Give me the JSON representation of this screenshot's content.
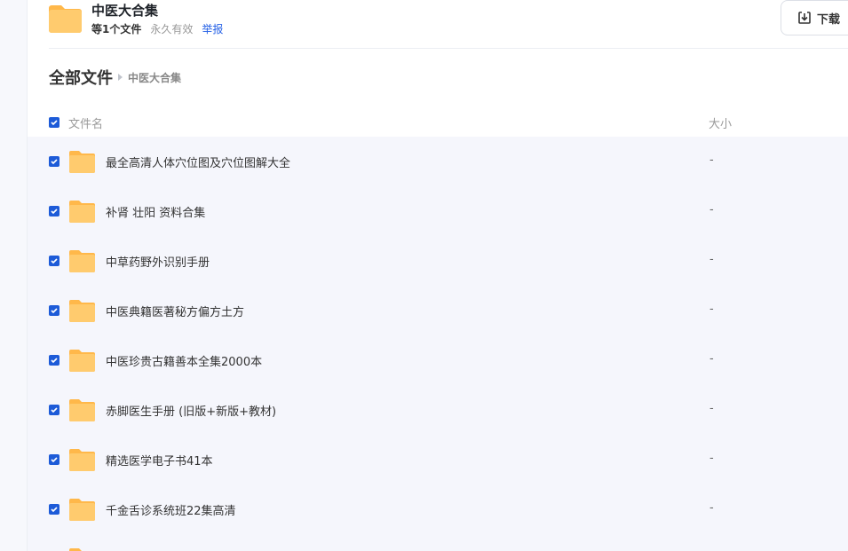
{
  "share": {
    "title": "中医大合集",
    "count_label": "等1个文件",
    "expiry_label": "永久有效",
    "report_label": "举报"
  },
  "toolbar": {
    "download_label": "下载"
  },
  "breadcrumb": {
    "root": "全部文件",
    "current": "中医大合集"
  },
  "list": {
    "columns": {
      "name": "文件名",
      "size": "大小"
    },
    "items": [
      {
        "name": "最全高清人体穴位图及穴位图解大全",
        "size": "-"
      },
      {
        "name": "补肾 壮阳 资料合集",
        "size": "-"
      },
      {
        "name": "中草药野外识别手册",
        "size": "-"
      },
      {
        "name": "中医典籍医著秘方偏方土方",
        "size": "-"
      },
      {
        "name": "中医珍贵古籍善本全集2000本",
        "size": "-"
      },
      {
        "name": "赤脚医生手册 (旧版+新版+教材)",
        "size": "-"
      },
      {
        "name": "精选医学电子书41本",
        "size": "-"
      },
      {
        "name": "千金舌诊系统班22集高清",
        "size": "-"
      },
      {
        "name": "",
        "size": ""
      }
    ]
  },
  "colors": {
    "accent": "#1d5bd8",
    "folder": "#ffc45c",
    "link": "#2561e6"
  }
}
